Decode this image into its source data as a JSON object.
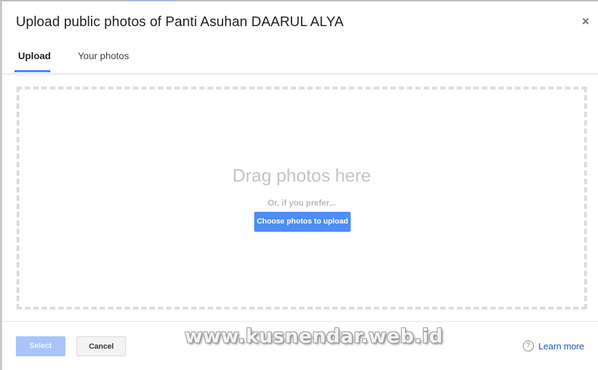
{
  "dialog": {
    "title": "Upload public photos of Panti Asuhan DAARUL ALYA",
    "close_icon": "×"
  },
  "tabs": [
    {
      "label": "Upload",
      "active": true
    },
    {
      "label": "Your photos",
      "active": false
    }
  ],
  "dropzone": {
    "heading": "Drag photos here",
    "subtext": "Or, if you prefer...",
    "choose_button": "Choose photos to upload"
  },
  "footer": {
    "select_button": "Select",
    "cancel_button": "Cancel",
    "help_icon": "?",
    "learn_more": "Learn more"
  },
  "watermark": "www.kusnendar.web.id",
  "colors": {
    "accent": "#4285f4",
    "link": "#1a50b0"
  }
}
